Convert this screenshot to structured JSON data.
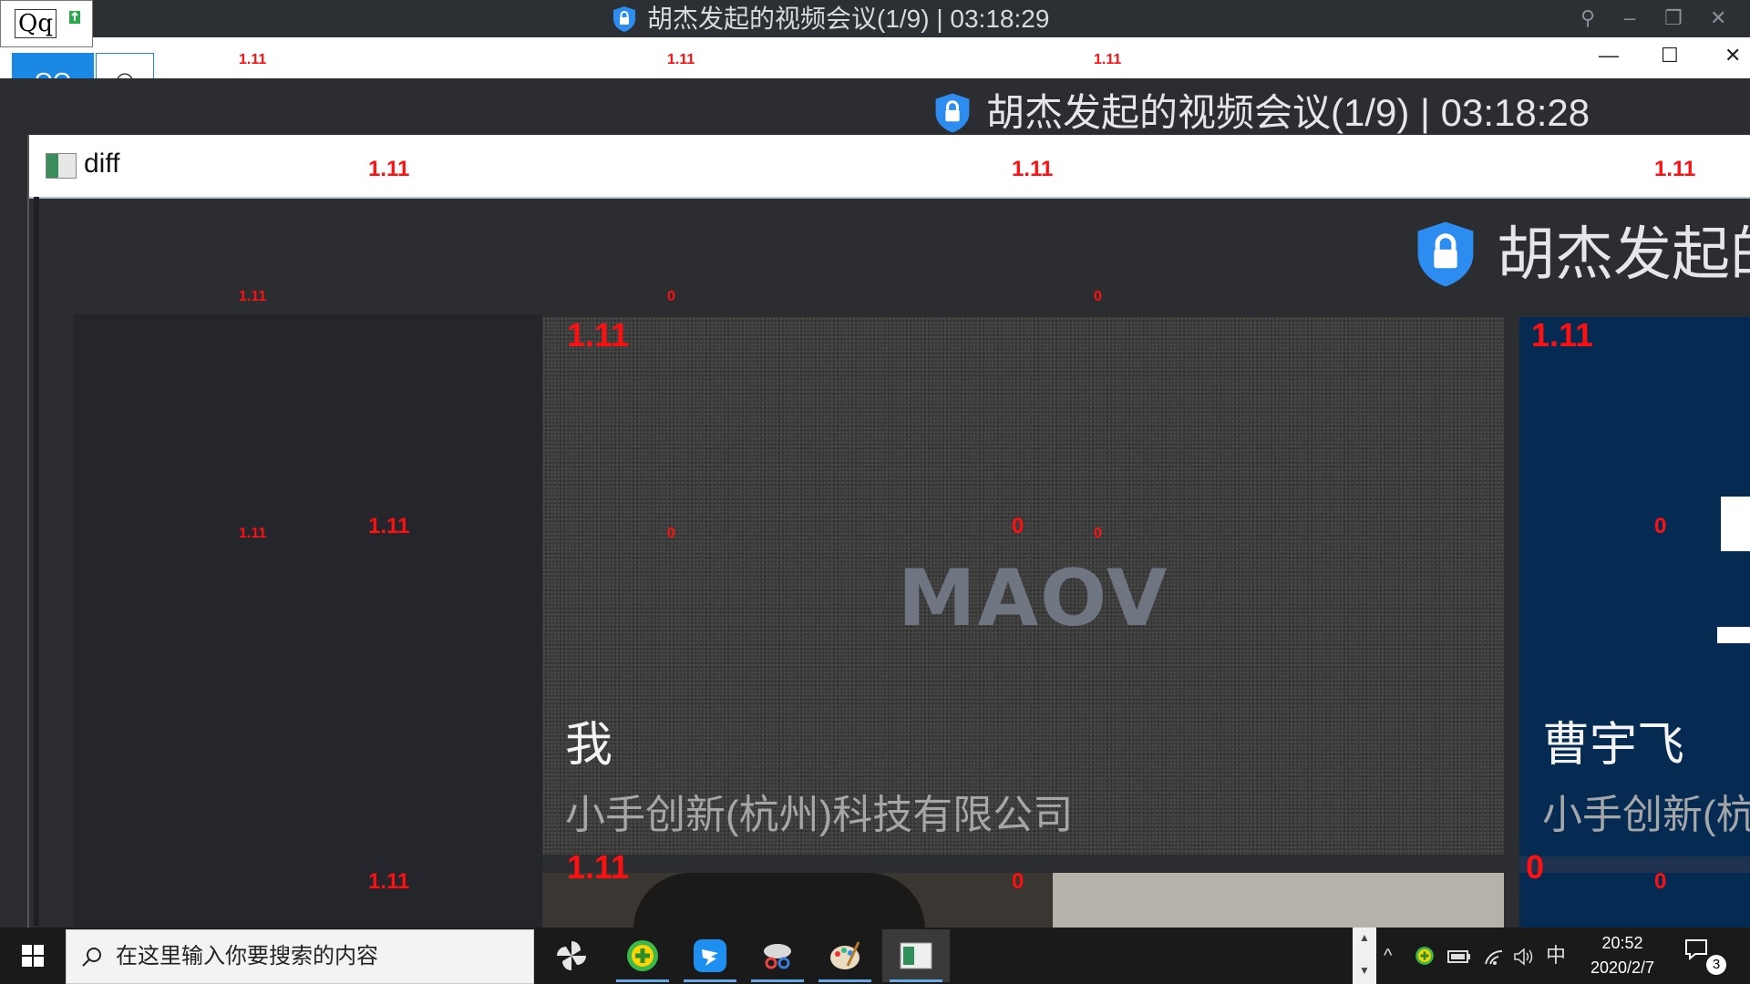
{
  "outer_window": {
    "title": "胡杰发起的视频会议(1/9) | 03:18:29"
  },
  "nested_window": {
    "title": "胡杰发起的视频会议(1/9) | 03:18:28"
  },
  "inner_window": {
    "title_partial": "胡杰发起的"
  },
  "qq_widget": {
    "font_preview": "Qq",
    "qq_label": "QQ",
    "emoji_label": "☺"
  },
  "diff_window": {
    "label": "diff"
  },
  "tiles": {
    "me": {
      "name": "我",
      "company": "小手创新(杭州)科技有限公司",
      "logo": "MAOV"
    },
    "cao": {
      "name": "曹宇飞",
      "company": "小手创新(杭"
    }
  },
  "diff_markers": {
    "a": "1.11",
    "b": "0"
  },
  "taskbar": {
    "search_placeholder": "在这里输入你要搜索的内容",
    "ime": "中",
    "time": "20:52",
    "date": "2020/2/7",
    "notification_count": "3"
  },
  "colors": {
    "accent": "#1b88e6",
    "marker": "#ff1010",
    "meeting_bg": "#2b2d31",
    "remote_tile": "#062b53"
  }
}
